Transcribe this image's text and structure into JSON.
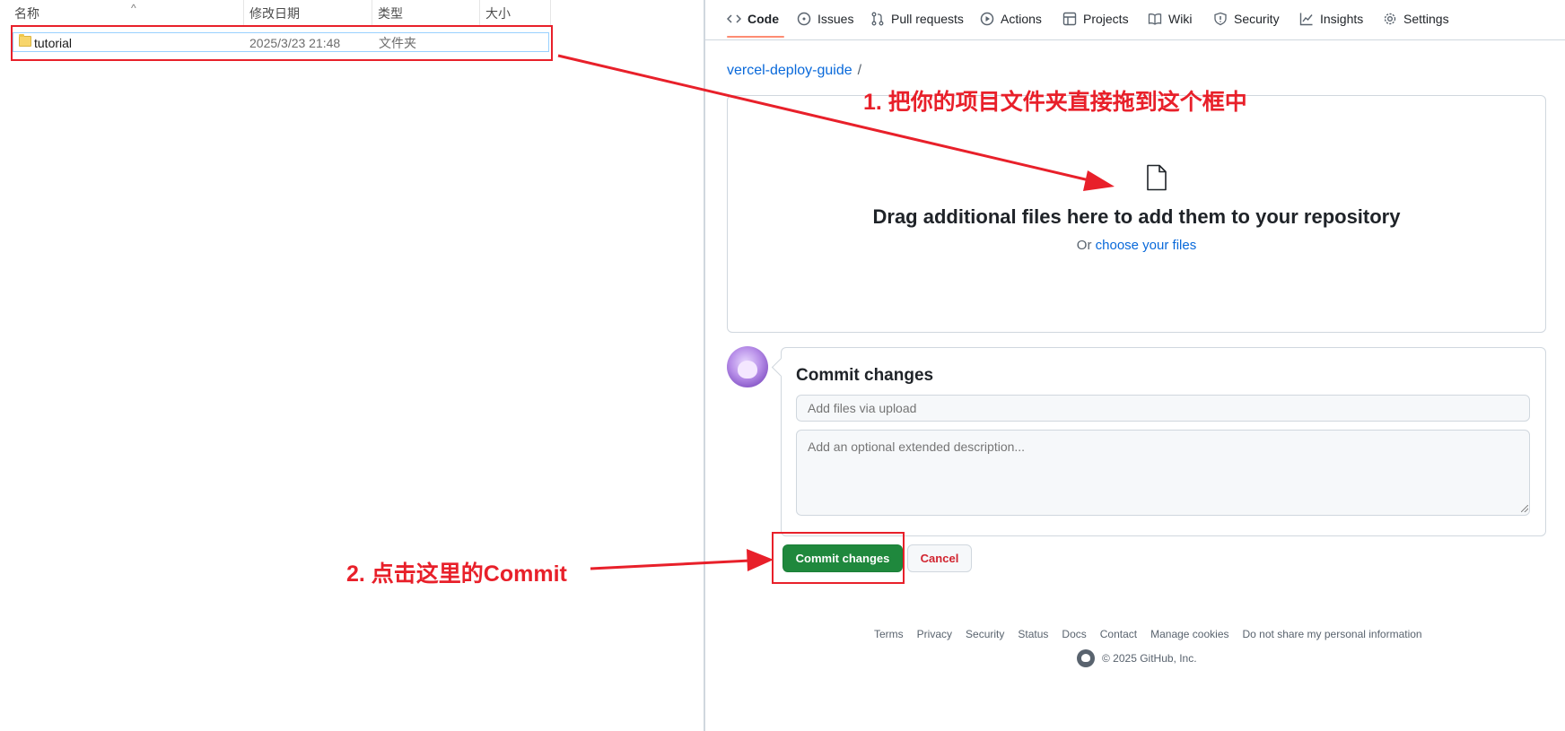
{
  "explorer": {
    "columns": [
      "名称",
      "修改日期",
      "类型",
      "大小"
    ],
    "rows": [
      {
        "name": "tutorial",
        "modified": "2025/3/23 21:48",
        "type": "文件夹",
        "size": ""
      }
    ]
  },
  "github": {
    "tabs": [
      {
        "label": "Code",
        "icon": "code-icon",
        "active": true
      },
      {
        "label": "Issues",
        "icon": "issue-opened-icon"
      },
      {
        "label": "Pull requests",
        "icon": "git-pull-request-icon"
      },
      {
        "label": "Actions",
        "icon": "play-icon"
      },
      {
        "label": "Projects",
        "icon": "table-icon"
      },
      {
        "label": "Wiki",
        "icon": "book-icon"
      },
      {
        "label": "Security",
        "icon": "shield-icon"
      },
      {
        "label": "Insights",
        "icon": "graph-icon"
      },
      {
        "label": "Settings",
        "icon": "gear-icon"
      }
    ],
    "breadcrumb": {
      "repo": "vercel-deploy-guide",
      "separator": "/"
    },
    "dropzone": {
      "title": "Drag additional files here to add them to your repository",
      "sub_prefix": "Or",
      "sub_link": "choose your files"
    },
    "commit": {
      "title": "Commit changes",
      "summary_placeholder": "Add files via upload",
      "description_placeholder": "Add an optional extended description...",
      "commit_button": "Commit changes",
      "cancel_button": "Cancel"
    },
    "footer": {
      "links": [
        "Terms",
        "Privacy",
        "Security",
        "Status",
        "Docs",
        "Contact",
        "Manage cookies",
        "Do not share my personal information"
      ],
      "copyright": "© 2025 GitHub, Inc."
    }
  },
  "annotations": {
    "step1": "1. 把你的项目文件夹直接拖到这个框中",
    "step2": "2. 点击这里的Commit",
    "color": "#e8202a"
  }
}
